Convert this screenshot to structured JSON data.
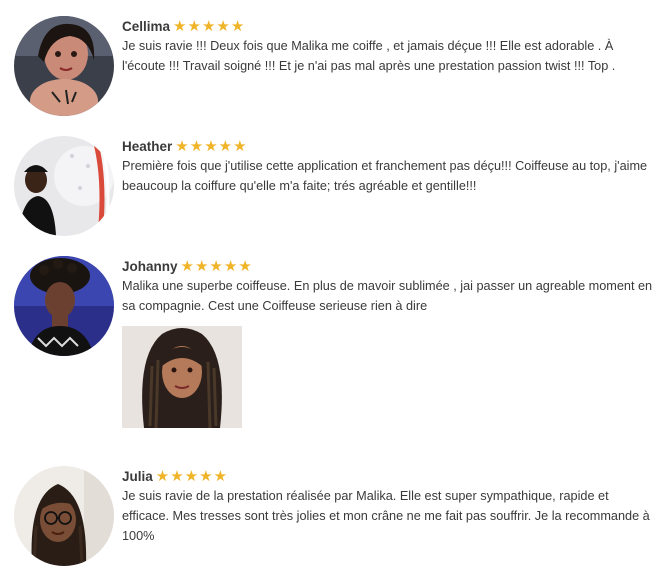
{
  "colors": {
    "star": "#f0b429",
    "text": "#3a3a3a",
    "name": "#3a3a3a"
  },
  "reviews": [
    {
      "name": "Cellima",
      "rating": 5,
      "text": "Je suis ravie !!! Deux fois que Malika me coiffe , et jamais déçue !!! Elle est adorable . À l'écoute !!! Travail soigné !!! Et je n'ai pas mal après une prestation passion twist !!! Top .",
      "avatar_icon": "user-avatar"
    },
    {
      "name": "Heather",
      "rating": 5,
      "text": "Première fois que j'utilise cette application et franchement pas déçu!!! Coiffeuse au top, j'aime beaucoup la coiffure qu'elle m'a faite; trés agréable et gentille!!!",
      "avatar_icon": "user-avatar"
    },
    {
      "name": "Johanny",
      "rating": 5,
      "text": "Malika une superbe coiffeuse. En plus de mavoir sublimée , jai passer un agreable moment en sa compagnie. Cest une Coiffeuse serieuse rien à dire",
      "avatar_icon": "user-avatar",
      "photo_icon": "review-photo"
    },
    {
      "name": "Julia",
      "rating": 5,
      "text": "Je suis ravie de la prestation réalisée par Malika. Elle est super sympathique, rapide et efficace. Mes tresses sont très jolies et mon crâne ne me fait pas souffrir. Je la recommande à 100%",
      "avatar_icon": "user-avatar"
    }
  ]
}
